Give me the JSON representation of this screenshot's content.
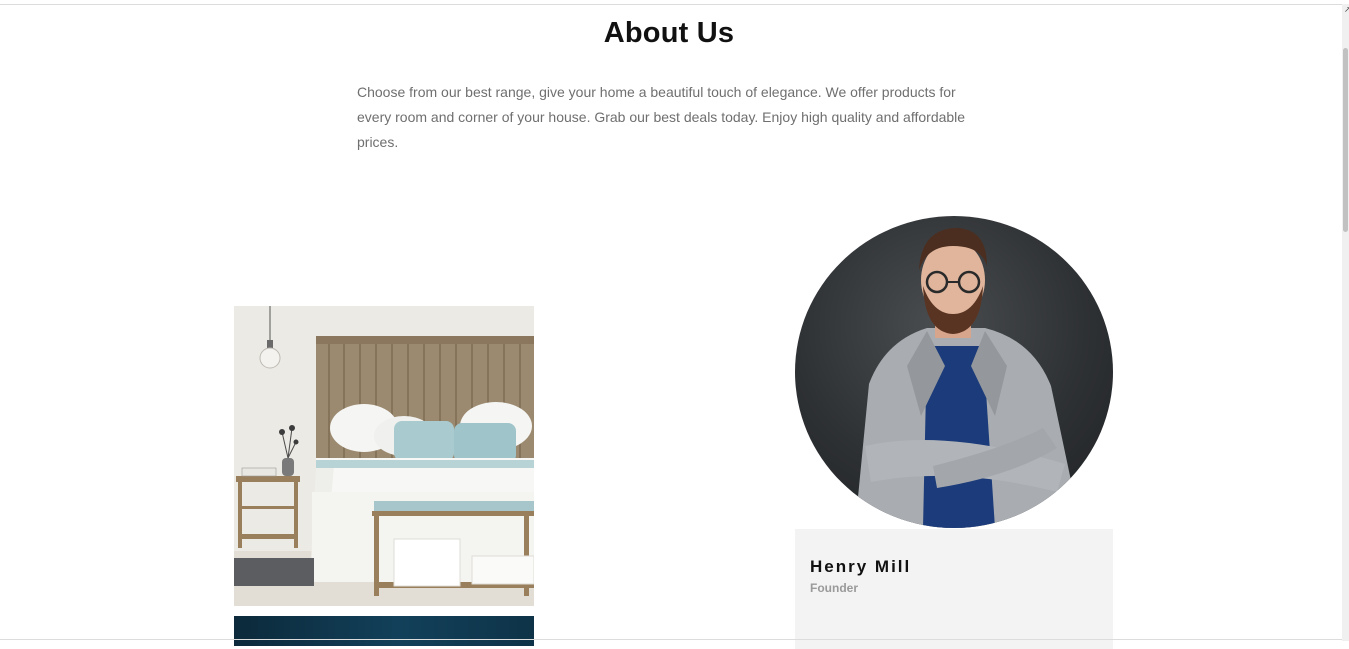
{
  "section": {
    "title": "About Us",
    "intro": "Choose from our best range, give your home a beautiful touch of elegance. We offer products for every room and corner of your house. Grab our best deals today. Enjoy high quality and affordable prices."
  },
  "founder": {
    "name": "Henry Mill",
    "role": "Founder"
  },
  "icons": {
    "scroll_corner": "resize-corner-icon"
  },
  "colors": {
    "title": "#111111",
    "body_text": "#6f6f6f",
    "card_bg": "#f3f3f3",
    "role_text": "#9a9a9a"
  }
}
